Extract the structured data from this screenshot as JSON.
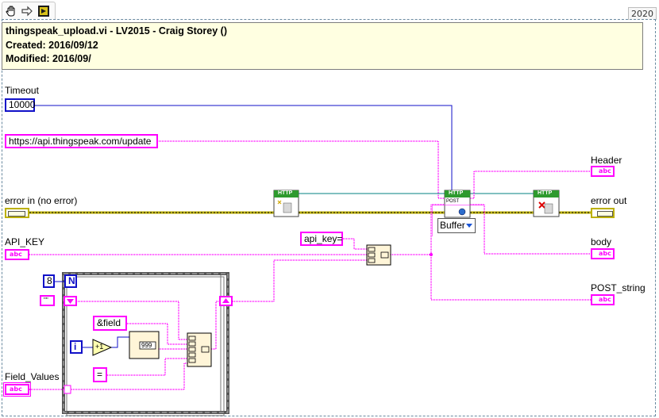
{
  "version": "2020",
  "comment": {
    "line1": "thingspeak_upload.vi - LV2015 - Craig Storey ()",
    "line2": "Created: 2016/09/12",
    "line3": "Modified: 2016/09/"
  },
  "controls": {
    "timeout_label": "Timeout",
    "timeout_value": "10000",
    "url_value": "https://api.thingspeak.com/update",
    "error_in_label": "error in (no error)",
    "api_key_label": "API_KEY",
    "field_values_label": "Field_Values"
  },
  "indicators": {
    "header_label": "Header",
    "error_out_label": "error out",
    "body_label": "body",
    "post_string_label": "POST_string"
  },
  "constants": {
    "api_key_prefix": "api_key=",
    "for_count": "8",
    "loop_count_terminal": "N",
    "loop_index_terminal": "i",
    "field_prefix": "&field",
    "equals": "=",
    "empty_string": "\"\"",
    "increment": "+1",
    "number_format": "999"
  },
  "nodes": {
    "http_badge": "HTTP",
    "post_label": "POST",
    "buffer_option": "Buffer",
    "string_terminal": "abc"
  },
  "colors": {
    "string_wire": "#ff00ff",
    "numeric_wire": "#1010c8",
    "error_wire": "#bcb000",
    "refnum_wire": "#008080",
    "comment_bg": "#ffffe1"
  }
}
